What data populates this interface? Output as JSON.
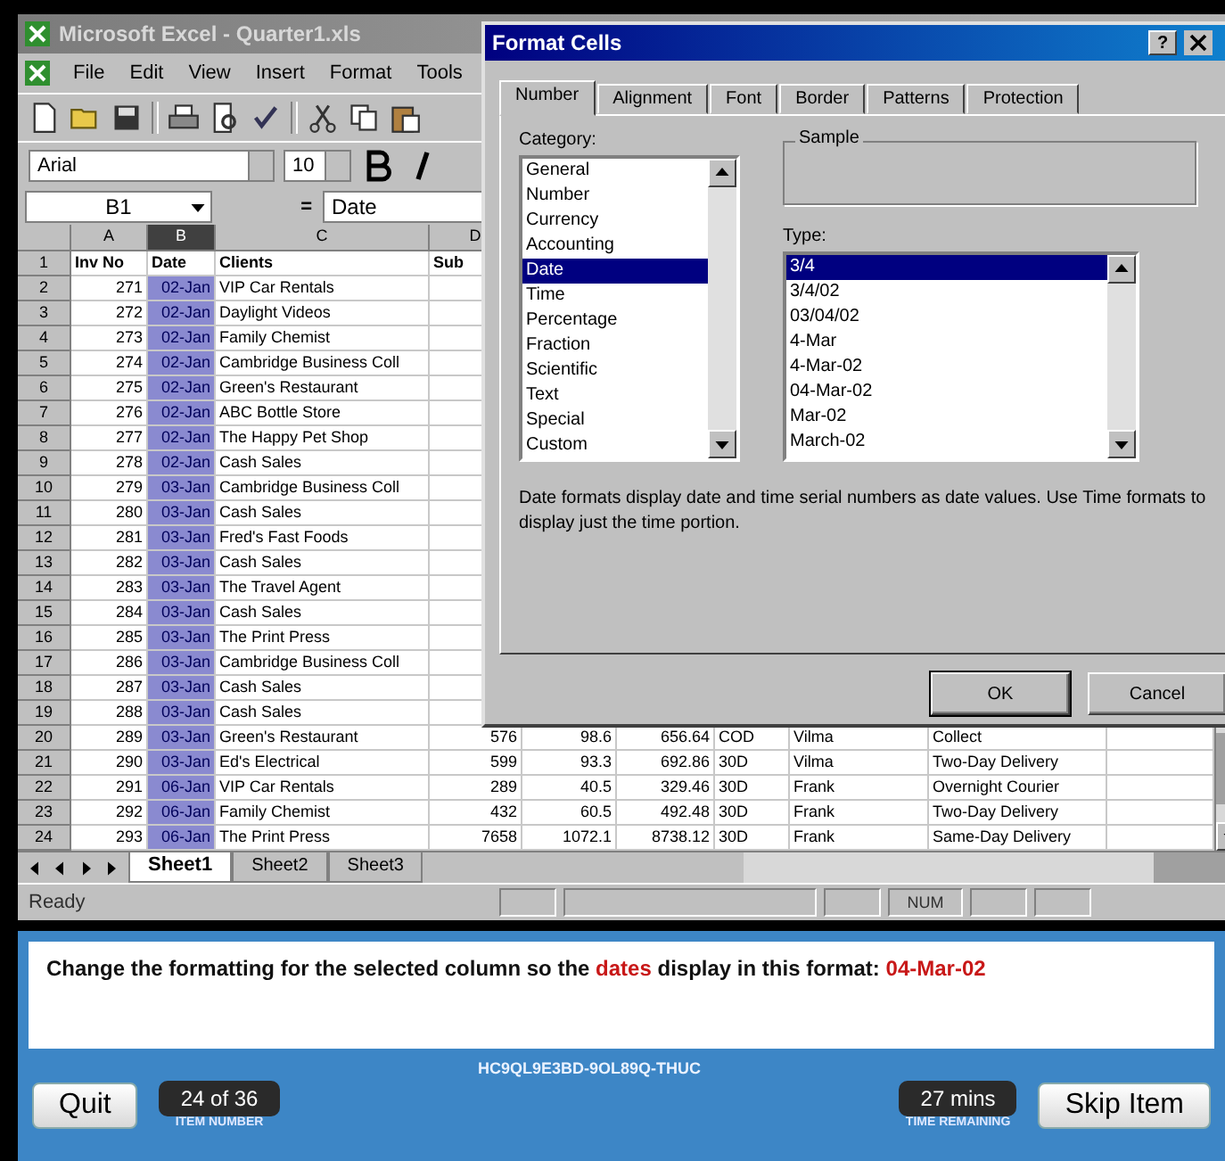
{
  "excel": {
    "title": "Microsoft Excel - Quarter1.xls",
    "menu": [
      "File",
      "Edit",
      "View",
      "Insert",
      "Format",
      "Tools"
    ],
    "font": "Arial",
    "size": "10",
    "name_box": "B1",
    "formula_sign": "=",
    "formula": "Date"
  },
  "sheet": {
    "columns": [
      {
        "label": "A",
        "selected": false
      },
      {
        "label": "B",
        "selected": true
      },
      {
        "label": "C",
        "selected": false
      },
      {
        "label": "D",
        "selected": false
      }
    ],
    "rows": [
      {
        "number": "1",
        "cells": [
          "Inv No",
          "Date",
          "Clients",
          "Sub"
        ]
      },
      {
        "number": "2",
        "cells": [
          "271",
          "02-Jan",
          "VIP Car Rentals"
        ]
      },
      {
        "number": "3",
        "cells": [
          "272",
          "02-Jan",
          "Daylight Videos"
        ]
      },
      {
        "number": "4",
        "cells": [
          "273",
          "02-Jan",
          "Family Chemist"
        ]
      },
      {
        "number": "5",
        "cells": [
          "274",
          "02-Jan",
          "Cambridge Business Coll"
        ]
      },
      {
        "number": "6",
        "cells": [
          "275",
          "02-Jan",
          "Green's Restaurant"
        ]
      },
      {
        "number": "7",
        "cells": [
          "276",
          "02-Jan",
          "ABC Bottle Store"
        ]
      },
      {
        "number": "8",
        "cells": [
          "277",
          "02-Jan",
          "The Happy Pet Shop"
        ]
      },
      {
        "number": "9",
        "cells": [
          "278",
          "02-Jan",
          "Cash Sales"
        ]
      },
      {
        "number": "10",
        "cells": [
          "279",
          "03-Jan",
          "Cambridge Business Coll"
        ]
      },
      {
        "number": "11",
        "cells": [
          "280",
          "03-Jan",
          "Cash Sales"
        ]
      },
      {
        "number": "12",
        "cells": [
          "281",
          "03-Jan",
          "Fred's Fast Foods"
        ]
      },
      {
        "number": "13",
        "cells": [
          "282",
          "03-Jan",
          "Cash Sales"
        ]
      },
      {
        "number": "14",
        "cells": [
          "283",
          "03-Jan",
          "The Travel Agent"
        ]
      },
      {
        "number": "15",
        "cells": [
          "284",
          "03-Jan",
          "Cash Sales"
        ]
      },
      {
        "number": "16",
        "cells": [
          "285",
          "03-Jan",
          "The Print Press"
        ]
      },
      {
        "number": "17",
        "cells": [
          "286",
          "03-Jan",
          "Cambridge Business Coll"
        ]
      },
      {
        "number": "18",
        "cells": [
          "287",
          "03-Jan",
          "Cash Sales"
        ]
      },
      {
        "number": "19",
        "cells": [
          "288",
          "03-Jan",
          "Cash Sales"
        ]
      },
      {
        "number": "20",
        "cells": [
          "289",
          "03-Jan",
          "Green's Restaurant",
          "576",
          "98.6",
          "656.64",
          "COD",
          "Vilma",
          "Collect"
        ]
      },
      {
        "number": "21",
        "cells": [
          "290",
          "03-Jan",
          "Ed's Electrical",
          "599",
          "93.3",
          "692.86",
          "30D",
          "Vilma",
          "Two-Day Delivery"
        ]
      },
      {
        "number": "22",
        "cells": [
          "291",
          "06-Jan",
          "VIP Car Rentals",
          "289",
          "40.5",
          "329.46",
          "30D",
          "Frank",
          "Overnight Courier"
        ]
      },
      {
        "number": "23",
        "cells": [
          "292",
          "06-Jan",
          "Family Chemist",
          "432",
          "60.5",
          "492.48",
          "30D",
          "Frank",
          "Two-Day Delivery"
        ]
      },
      {
        "number": "24",
        "cells": [
          "293",
          "06-Jan",
          "The Print Press",
          "7658",
          "1072.1",
          "8738.12",
          "30D",
          "Frank",
          "Same-Day Delivery"
        ]
      }
    ]
  },
  "sheet_tabs": [
    {
      "label": "Sheet1",
      "selected": true
    },
    {
      "label": "Sheet2",
      "selected": false
    },
    {
      "label": "Sheet3",
      "selected": false
    }
  ],
  "status": {
    "text": "Ready",
    "indicator": "NUM"
  },
  "dialog": {
    "title": "Format Cells",
    "help": "?",
    "tabs": [
      {
        "label": "Number",
        "selected": true
      },
      {
        "label": "Alignment",
        "selected": false
      },
      {
        "label": "Font",
        "selected": false
      },
      {
        "label": "Border",
        "selected": false
      },
      {
        "label": "Patterns",
        "selected": false
      },
      {
        "label": "Protection",
        "selected": false
      }
    ],
    "category_label": "Category:",
    "categories": [
      {
        "label": "General",
        "selected": false
      },
      {
        "label": "Number",
        "selected": false
      },
      {
        "label": "Currency",
        "selected": false
      },
      {
        "label": "Accounting",
        "selected": false
      },
      {
        "label": "Date",
        "selected": true
      },
      {
        "label": "Time",
        "selected": false
      },
      {
        "label": "Percentage",
        "selected": false
      },
      {
        "label": "Fraction",
        "selected": false
      },
      {
        "label": "Scientific",
        "selected": false
      },
      {
        "label": "Text",
        "selected": false
      },
      {
        "label": "Special",
        "selected": false
      },
      {
        "label": "Custom",
        "selected": false
      }
    ],
    "sample_label": "Sample",
    "type_label": "Type:",
    "types": [
      {
        "label": "3/4",
        "selected": true
      },
      {
        "label": "3/4/02",
        "selected": false
      },
      {
        "label": "03/04/02",
        "selected": false
      },
      {
        "label": "4-Mar",
        "selected": false
      },
      {
        "label": "4-Mar-02",
        "selected": false
      },
      {
        "label": "04-Mar-02",
        "selected": false
      },
      {
        "label": "Mar-02",
        "selected": false
      },
      {
        "label": "March-02",
        "selected": false
      }
    ],
    "description": "Date formats display date and time serial numbers as date values.  Use Time formats to display just the time portion.",
    "buttons": [
      "OK",
      "Cancel"
    ]
  },
  "question": {
    "segments": [
      {
        "text": "Change the formatting for the selected column so the ",
        "highlight": false
      },
      {
        "text": "dates",
        "highlight": true
      },
      {
        "text": " display in this format: ",
        "highlight": false
      },
      {
        "text": "04-Mar-02",
        "highlight": true
      }
    ]
  },
  "footer": {
    "quit": "Quit",
    "item": "24 of 36",
    "item_label": "ITEM NUMBER",
    "code": "HC9QL9E3BD-9OL89Q-THUC",
    "time": "27 mins",
    "time_label": "TIME REMAINING",
    "skip": "Skip Item"
  }
}
